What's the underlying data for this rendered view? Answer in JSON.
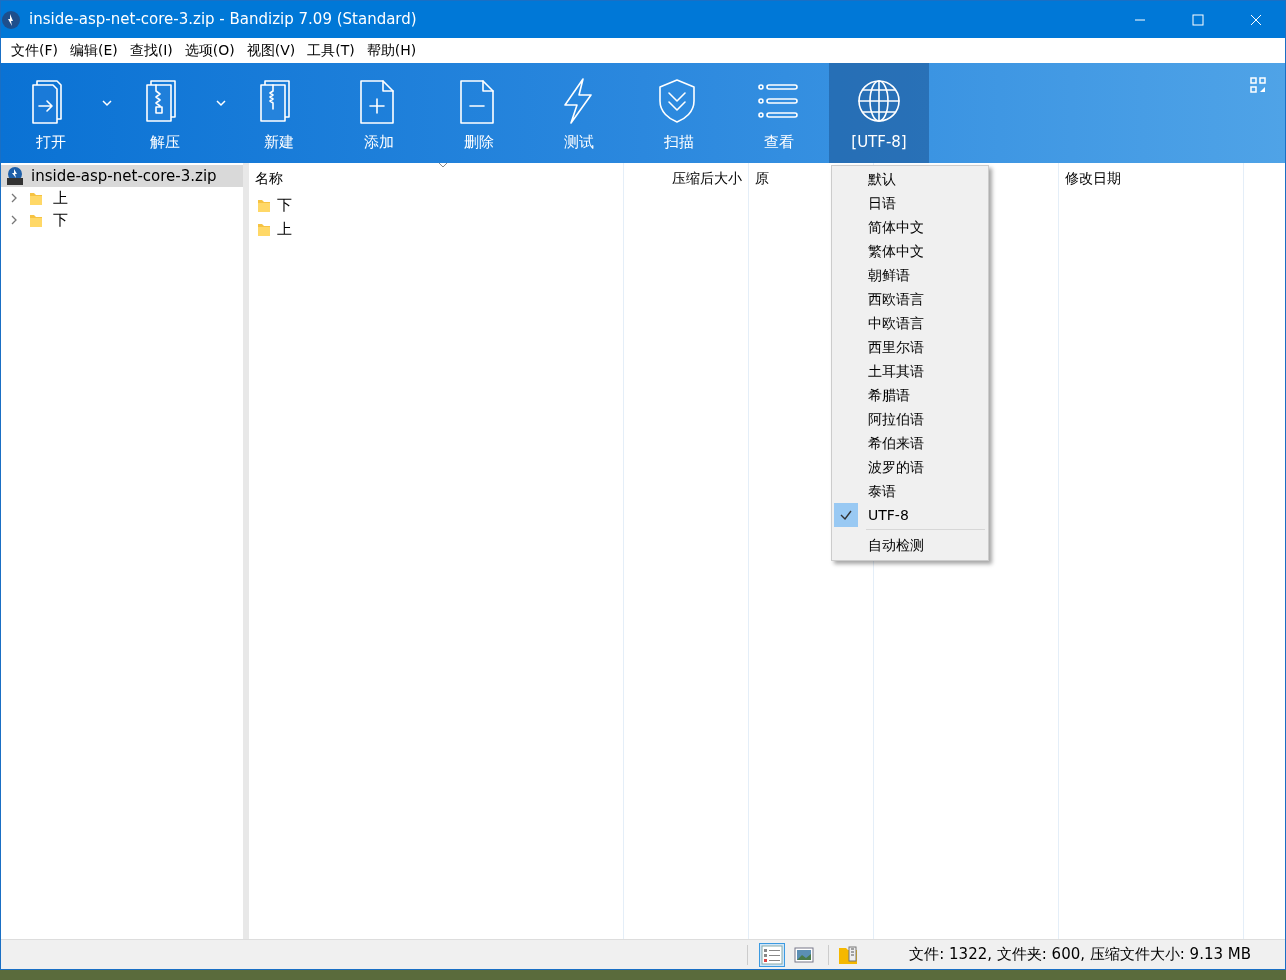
{
  "window": {
    "title": "inside-asp-net-core-3.zip - Bandizip 7.09 (Standard)"
  },
  "menu_bar": [
    "文件(F)",
    "编辑(E)",
    "查找(I)",
    "选项(O)",
    "视图(V)",
    "工具(T)",
    "帮助(H)"
  ],
  "toolbar": [
    {
      "label": "打开",
      "kind": "open",
      "dropdown": true,
      "selected": false
    },
    {
      "label": "解压",
      "kind": "extract",
      "dropdown": true,
      "selected": false
    },
    {
      "label": "新建",
      "kind": "new",
      "dropdown": false,
      "selected": false
    },
    {
      "label": "添加",
      "kind": "add",
      "dropdown": false,
      "selected": false
    },
    {
      "label": "删除",
      "kind": "delete",
      "dropdown": false,
      "selected": false
    },
    {
      "label": "测试",
      "kind": "test",
      "dropdown": false,
      "selected": false
    },
    {
      "label": "扫描",
      "kind": "scan",
      "dropdown": false,
      "selected": false
    },
    {
      "label": "查看",
      "kind": "view",
      "dropdown": false,
      "selected": false
    },
    {
      "label": "[UTF-8]",
      "kind": "encoding",
      "dropdown": false,
      "selected": true
    }
  ],
  "tree": {
    "root": {
      "label": "inside-asp-net-core-3.zip",
      "selected": true
    },
    "children": [
      {
        "label": "上",
        "expanded": false
      },
      {
        "label": "下",
        "expanded": false
      }
    ]
  },
  "file_list": {
    "columns": [
      {
        "label": "名称"
      },
      {
        "label": "压缩后大小"
      },
      {
        "label": "原"
      },
      {
        "label": "修改日期"
      }
    ],
    "rows": [
      {
        "name": "下"
      },
      {
        "name": "上"
      }
    ]
  },
  "encoding_menu": {
    "options": [
      {
        "label": "默认",
        "checked": false
      },
      {
        "label": "日语",
        "checked": false
      },
      {
        "label": "简体中文",
        "checked": false
      },
      {
        "label": "繁体中文",
        "checked": false
      },
      {
        "label": "朝鲜语",
        "checked": false
      },
      {
        "label": "西欧语言",
        "checked": false
      },
      {
        "label": "中欧语言",
        "checked": false
      },
      {
        "label": "西里尔语",
        "checked": false
      },
      {
        "label": "土耳其语",
        "checked": false
      },
      {
        "label": "希腊语",
        "checked": false
      },
      {
        "label": "阿拉伯语",
        "checked": false
      },
      {
        "label": "希伯来语",
        "checked": false
      },
      {
        "label": "波罗的语",
        "checked": false
      },
      {
        "label": "泰语",
        "checked": false
      },
      {
        "label": "UTF-8",
        "checked": true
      }
    ],
    "extra": "自动检测"
  },
  "status_bar": {
    "view_buttons": [
      {
        "kind": "details",
        "selected": true
      },
      {
        "kind": "thumbnail",
        "selected": false
      }
    ],
    "text": "文件: 1322, 文件夹: 600, 压缩文件大小: 9.13 MB"
  }
}
